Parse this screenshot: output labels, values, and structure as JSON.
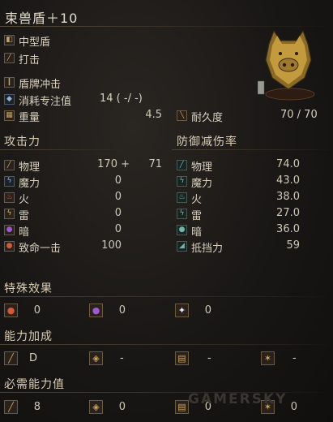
{
  "title": "束兽盾＋10",
  "header": {
    "category": "中型盾",
    "attack_type": "打击",
    "skill": "盾牌冲击",
    "fp_label": "消耗专注值",
    "fp_value": "14 (   -/   -)",
    "weight_label": "重量",
    "weight_value": "4.5",
    "durability_label": "耐久度",
    "durability_value": "70 /    70"
  },
  "attack": {
    "heading": "攻击力",
    "rows": [
      {
        "label": "物理",
        "value": "170 +",
        "bonus": "71"
      },
      {
        "label": "魔力",
        "value": "0",
        "bonus": ""
      },
      {
        "label": "火",
        "value": "0",
        "bonus": ""
      },
      {
        "label": "雷",
        "value": "0",
        "bonus": ""
      },
      {
        "label": "暗",
        "value": "0",
        "bonus": ""
      },
      {
        "label": "致命一击",
        "value": "100",
        "bonus": ""
      }
    ]
  },
  "defense": {
    "heading": "防御减伤率",
    "rows": [
      {
        "label": "物理",
        "value": "74.0"
      },
      {
        "label": "魔力",
        "value": "43.0"
      },
      {
        "label": "火",
        "value": "38.0"
      },
      {
        "label": "雷",
        "value": "27.0"
      },
      {
        "label": "暗",
        "value": "36.0"
      },
      {
        "label": "抵挡力",
        "value": "59"
      }
    ]
  },
  "effects": {
    "heading": "特殊效果",
    "values": [
      "0",
      "0",
      "0"
    ]
  },
  "scaling": {
    "heading": "能力加成",
    "values": [
      "D",
      "-",
      "-",
      "-"
    ]
  },
  "requirements": {
    "heading": "必需能力值",
    "values": [
      "8",
      "0",
      "0",
      "0"
    ]
  },
  "watermark": "GAMERSKY",
  "colors": {
    "background": "#141211",
    "text": "#d9d2c2",
    "icon_border": "#6b5a42"
  }
}
